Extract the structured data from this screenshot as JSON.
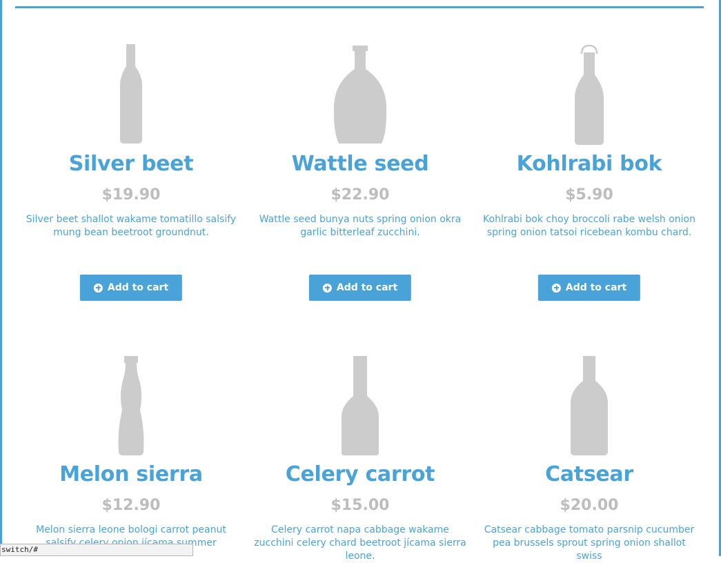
{
  "products": [
    {
      "name": "Silver beet",
      "price": "$19.90",
      "description": "Silver beet shallot wakame tomatillo salsify mung bean beetroot groundnut.",
      "button_label": "Add to cart"
    },
    {
      "name": "Wattle seed",
      "price": "$22.90",
      "description": "Wattle seed bunya nuts spring onion okra garlic bitterleaf zucchini.",
      "button_label": "Add to cart"
    },
    {
      "name": "Kohlrabi bok",
      "price": "$5.90",
      "description": "Kohlrabi bok choy broccoli rabe welsh onion spring onion tatsoi ricebean kombu chard.",
      "button_label": "Add to cart"
    },
    {
      "name": "Melon sierra",
      "price": "$12.90",
      "description": "Melon sierra leone bologi carrot peanut salsify celery onion jícama summer"
    },
    {
      "name": "Celery carrot",
      "price": "$15.00",
      "description": "Celery carrot napa cabbage wakame zucchini celery chard beetroot jícama sierra leone."
    },
    {
      "name": "Catsear",
      "price": "$20.00",
      "description": "Catsear cabbage tomato parsnip cucumber pea brussels sprout spring onion shallot swiss"
    }
  ],
  "status_bar": {
    "url": "switch/#"
  },
  "colors": {
    "accent": "#4aa3d8",
    "price": "#bdbdbd",
    "bottle": "#cccccc"
  }
}
